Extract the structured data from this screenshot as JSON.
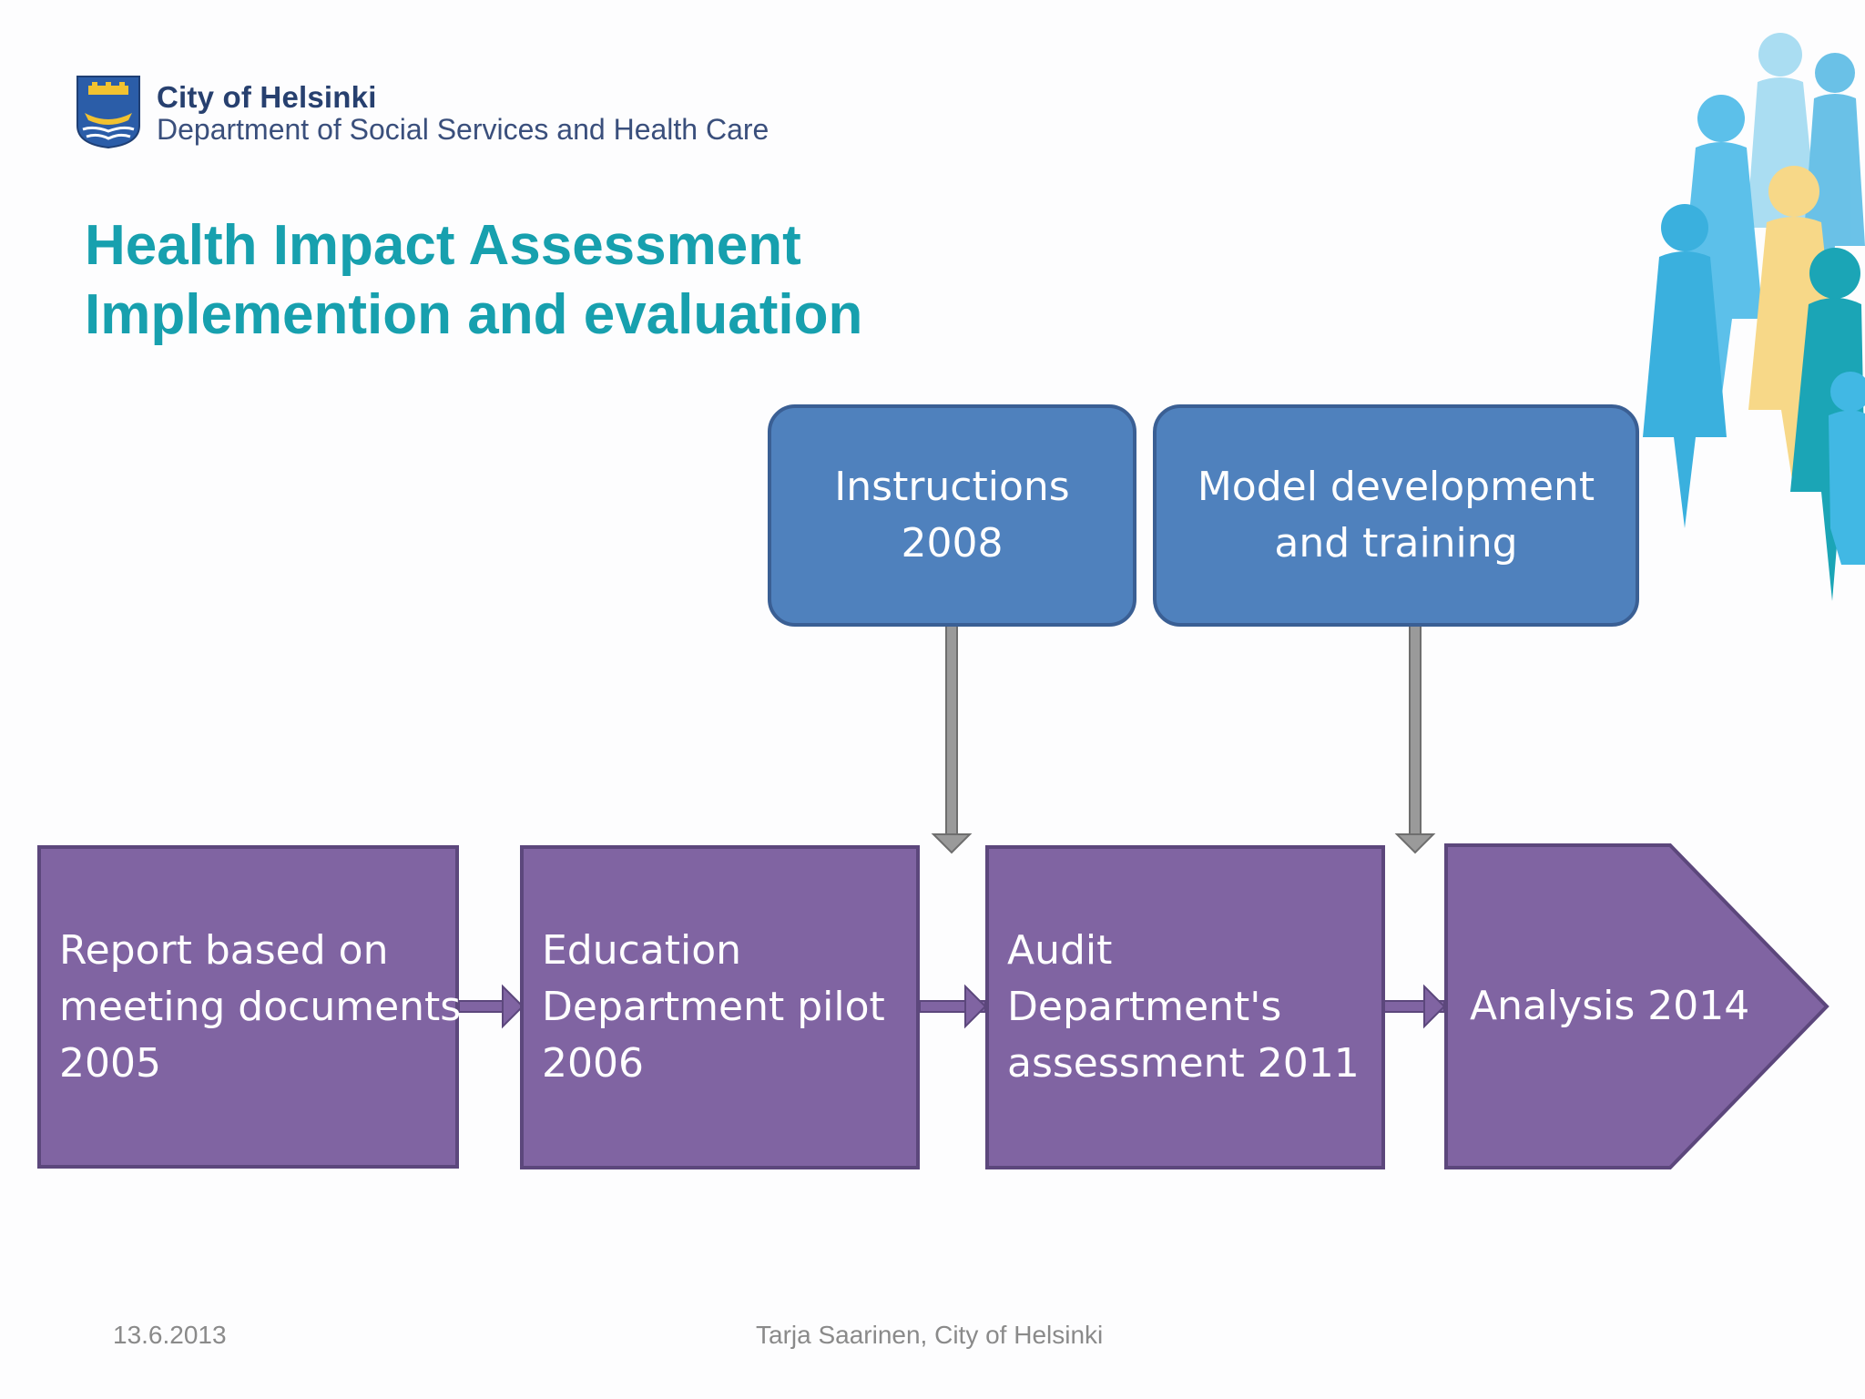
{
  "header": {
    "org_name": "City of Helsinki",
    "department": "Department of Social Services and Health Care"
  },
  "title": {
    "line1": "Health Impact Assessment",
    "line2": "Implemention and evaluation"
  },
  "inputs": [
    {
      "lines": [
        "Instructions",
        "2008"
      ]
    },
    {
      "lines": [
        "Model development",
        "and training"
      ]
    }
  ],
  "process": [
    {
      "lines": [
        "Report based on",
        "meeting documents",
        "2005"
      ]
    },
    {
      "lines": [
        "Education",
        "Department pilot",
        "2006"
      ]
    },
    {
      "lines": [
        "Audit",
        "Department's",
        "assessment 2011"
      ]
    },
    {
      "lines": [
        "Analysis 2014"
      ]
    }
  ],
  "footer": {
    "date": "13.6.2013",
    "author": "Tarja Saarinen, City of Helsinki"
  },
  "colors": {
    "title": "#17a0ae",
    "blue_box": "#4f81bd",
    "purple_box": "#8064a2",
    "footer_text": "#8a8a8a"
  }
}
